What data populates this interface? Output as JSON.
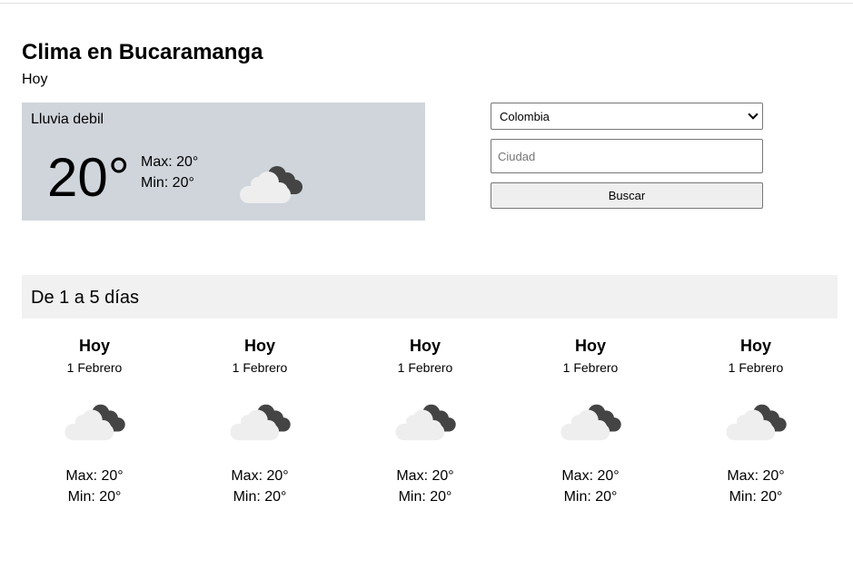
{
  "page": {
    "title": "Clima en Bucaramanga",
    "subtitle": "Hoy"
  },
  "current": {
    "description": "Lluvia debil",
    "temperature": "20°",
    "max": "Max: 20°",
    "min": "Min: 20°",
    "icon": "night-cloudy-icon"
  },
  "search": {
    "country_selected": "Colombia",
    "city_value": "",
    "city_placeholder": "Ciudad",
    "button_label": "Buscar"
  },
  "forecast": {
    "header": "De 1 a 5 días",
    "days": [
      {
        "label": "Hoy",
        "date": "1 Febrero",
        "max": "Max: 20°",
        "min": "Min: 20°",
        "icon": "night-cloudy-icon"
      },
      {
        "label": "Hoy",
        "date": "1 Febrero",
        "max": "Max: 20°",
        "min": "Min: 20°",
        "icon": "night-cloudy-icon"
      },
      {
        "label": "Hoy",
        "date": "1 Febrero",
        "max": "Max: 20°",
        "min": "Min: 20°",
        "icon": "night-cloudy-icon"
      },
      {
        "label": "Hoy",
        "date": "1 Febrero",
        "max": "Max: 20°",
        "min": "Min: 20°",
        "icon": "night-cloudy-icon"
      },
      {
        "label": "Hoy",
        "date": "1 Febrero",
        "max": "Max: 20°",
        "min": "Min: 20°",
        "icon": "night-cloudy-icon"
      }
    ]
  },
  "colors": {
    "current_card_bg": "#cfd5db",
    "forecast_header_bg": "#f1f1f1",
    "cloud_light": "#eeeeee",
    "cloud_dark": "#444444"
  }
}
